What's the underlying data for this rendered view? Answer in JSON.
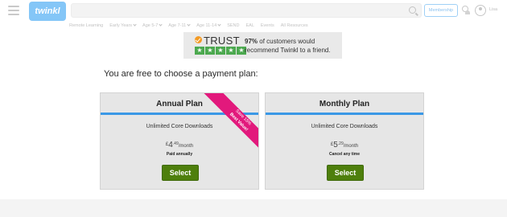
{
  "header": {
    "logo_text": "twinkl",
    "search_placeholder": "",
    "membership_label": "Membership",
    "user_label": "Lisa"
  },
  "nav": {
    "items": [
      {
        "label": "Remote Learning",
        "dropdown": false
      },
      {
        "label": "Early Years",
        "dropdown": true
      },
      {
        "label": "Age 5-7",
        "dropdown": true
      },
      {
        "label": "Age 7-11",
        "dropdown": true
      },
      {
        "label": "Age 11-14",
        "dropdown": true
      },
      {
        "label": "SEND",
        "dropdown": false
      },
      {
        "label": "EAL",
        "dropdown": false
      },
      {
        "label": "Events",
        "dropdown": false
      },
      {
        "label": "All Resources",
        "dropdown": false
      }
    ]
  },
  "trust_banner": {
    "brand": "TRUST",
    "stars": [
      "★",
      "★",
      "★",
      "★",
      "★"
    ],
    "percent": "97%",
    "message": " of customers would recommend Twinkl to a friend."
  },
  "headline": "You are free to choose a payment plan:",
  "plans": [
    {
      "title": "Annual Plan",
      "feature": "Unlimited Core Downloads",
      "currency": "£",
      "price_main": "4",
      "price_pence": ".49",
      "period": "/month",
      "note": "Paid annually",
      "button": "Select",
      "ribbon_line1": "Save 15%",
      "ribbon_line2": "Best Value!"
    },
    {
      "title": "Monthly Plan",
      "feature": "Unlimited Core Downloads",
      "currency": "£",
      "price_main": "5",
      "price_pence": ".29",
      "period": "/month",
      "note": "Cancel any time",
      "button": "Select"
    }
  ],
  "colors": {
    "accent_stripe": "#3b98e6",
    "select_button": "#4e7f0c",
    "ribbon": "#e2197c",
    "trust_stars": "#4ca94f",
    "trust_mark": "#f39a24"
  }
}
